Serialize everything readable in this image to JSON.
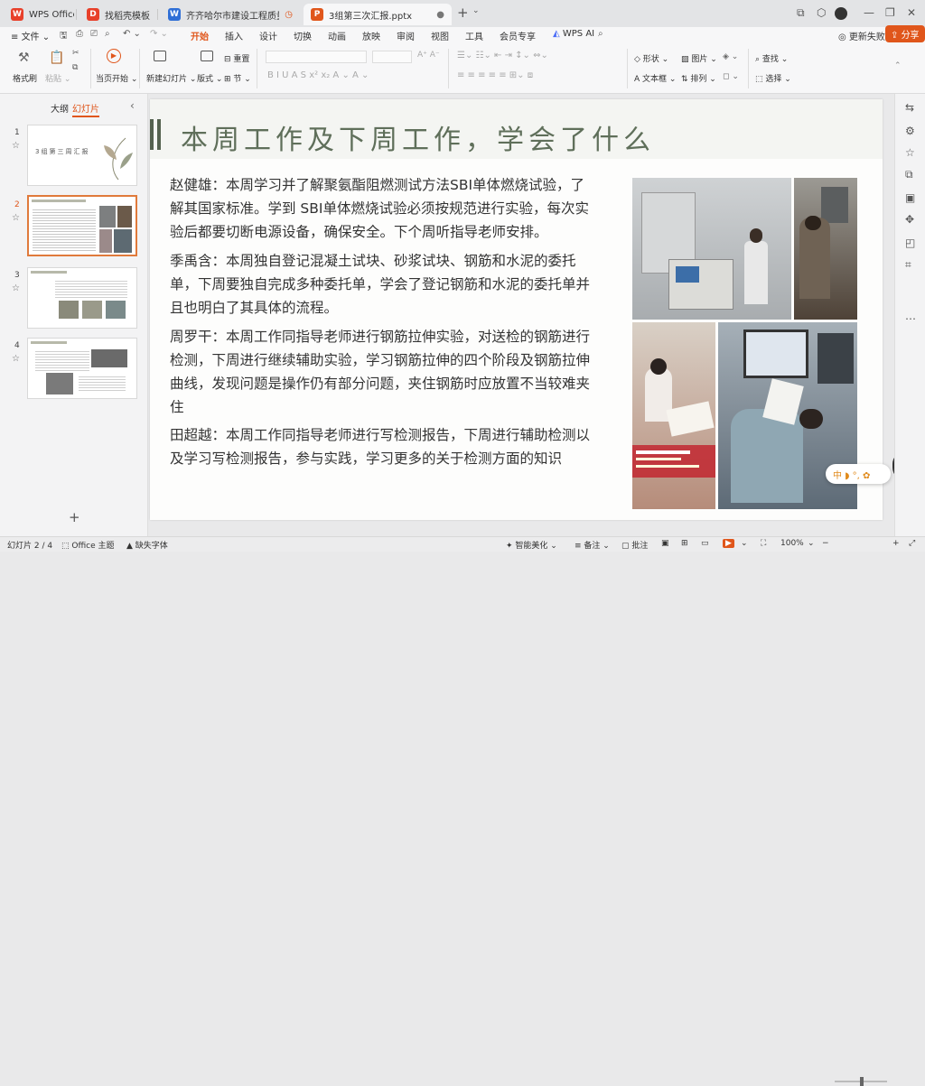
{
  "tabs": [
    {
      "label": "WPS Office",
      "icon": "wps-logo-icon"
    },
    {
      "label": "找稻壳模板",
      "icon": "docer-icon"
    },
    {
      "label": "齐齐哈尔市建设工程质量检测",
      "icon": "word-doc-icon"
    },
    {
      "label": "3组第三次汇报.pptx",
      "icon": "ppt-file-icon"
    }
  ],
  "menu": {
    "file": "文件",
    "items": [
      "开始",
      "插入",
      "设计",
      "切换",
      "动画",
      "放映",
      "审阅",
      "视图",
      "工具",
      "会员专享"
    ],
    "active": "开始",
    "wps_ai": "WPS AI",
    "update_failed": "更新失败",
    "share": "分享"
  },
  "ribbon": {
    "format_painter": "格式刷",
    "paste": "粘贴",
    "from_current": "当页开始",
    "new_slide": "新建幻灯片",
    "layout": "版式",
    "reset": "重置",
    "section": "节",
    "shape": "形状",
    "picture": "图片",
    "textbox": "文本框",
    "arrange": "排列",
    "find": "查找",
    "select": "选择"
  },
  "left_panel": {
    "tab_outline": "大纲",
    "tab_slides": "幻灯片",
    "slides": [
      {
        "num": "1"
      },
      {
        "num": "2"
      },
      {
        "num": "3"
      },
      {
        "num": "4"
      }
    ],
    "thumb1_title": "3组第三周汇报",
    "add_symbol": "+"
  },
  "slide": {
    "title": "本周工作及下周工作，学会了什么",
    "paragraphs": [
      "赵健雄：本周学习并了解聚氨酯阻燃测试方法SBI单体燃烧试验，了解其国家标准。学到 SBI单体燃烧试验必须按规范进行实验，每次实验后都要切断电源设备，确保安全。下个周听指导老师安排。",
      "季禹含：本周独自登记混凝土试块、砂浆试块、钢筋和水泥的委托单，下周要独自完成多种委托单，学会了登记钢筋和水泥的委托单并且也明白了其具体的流程。",
      "周罗干：本周工作同指导老师进行钢筋拉伸实验，对送检的钢筋进行检测，下周进行继续辅助实验，学习钢筋拉伸的四个阶段及钢筋拉伸曲线，发现问题是操作仍有部分问题，夹住钢筋时应放置不当较难夹住",
      "田超越：本周工作同指导老师进行写检测报告，下周进行辅助检测以及学习写检测报告，参与实践，学习更多的关于检测方面的知识"
    ]
  },
  "status": {
    "slide_info": "幻灯片 2 / 4",
    "theme": "Office 主题",
    "missing_font": "缺失字体",
    "beautify": "智能美化",
    "notes": "备注",
    "comments": "批注",
    "zoom": "100%"
  },
  "colors": {
    "accent": "#e0561b",
    "title": "#5f6f5a"
  }
}
